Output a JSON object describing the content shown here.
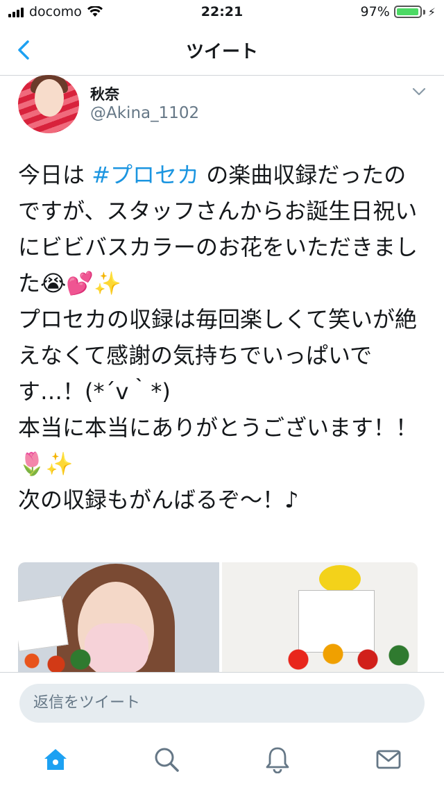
{
  "status_bar": {
    "carrier": "docomo",
    "time": "22:21",
    "battery_percent": "97%",
    "battery_level": 0.97
  },
  "nav": {
    "title": "ツイート",
    "back_icon": "chevron-left-icon"
  },
  "tweet": {
    "display_name": "秋奈",
    "handle": "@Akina_1102",
    "text_before_hashtag": "今日は ",
    "hashtag": "#プロセカ",
    "text_after_hashtag": " の楽曲収録だったのですが、スタッフさんからお誕生日祝いにビビバスカラーのお花をいただきました😭💕✨\nプロセカの収録は毎回楽しくて笑いが絶えなくて感謝の気持ちでいっぱいです…！(*´v｀*)\n本当に本当にありがとうございます！！🌷✨\n次の収録もがんばるぞ〜！♪",
    "menu_icon": "chevron-down-icon"
  },
  "reply": {
    "placeholder": "返信をツイート"
  },
  "tab_bar": {
    "items": [
      "home-icon",
      "search-icon",
      "notifications-icon",
      "messages-icon"
    ],
    "active_color": "#1da1f2",
    "inactive_color": "#657786"
  }
}
